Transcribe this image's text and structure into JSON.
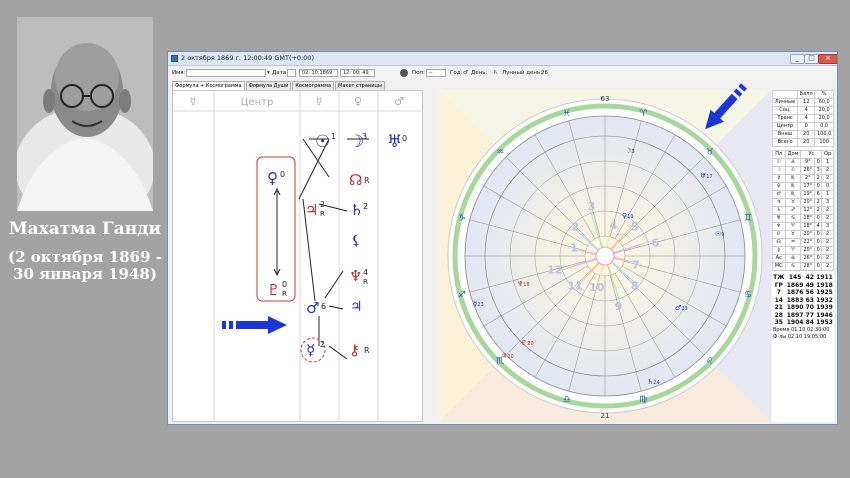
{
  "caption": {
    "name": "Махатма Ганди",
    "dates": "(2 октября 1869 - 30 января 1948)"
  },
  "window": {
    "title": "2 октября 1869 г. 12:00:49 GMT(+0:00)",
    "buttons": [
      "_",
      "□",
      "×"
    ]
  },
  "toolbar": {
    "name_label": "Имя:",
    "date_label": "Дата:",
    "date_value": "02. 10.1869",
    "time_value": "12: 00: 49",
    "sex_label": "Пол:",
    "sex_value": "--",
    "year_label": "Год:",
    "year_sym": "♂",
    "day_label": "День:",
    "day_sym": "♄",
    "lunar_label": "Лунный день:",
    "lunar_value": "26"
  },
  "tabs": [
    "Формула + Космограмма",
    "Формула Души",
    "Космограмма",
    "Макет страницы"
  ],
  "formula": {
    "headers": [
      "☿",
      "Центр",
      "☿",
      "♀",
      "♂"
    ],
    "planets": [
      {
        "sym": "☉",
        "num": "1",
        "color": "#1f35b8"
      },
      {
        "sym": "☽",
        "num": "3",
        "color": "#1f35b8"
      },
      {
        "sym": "♅",
        "num": "0",
        "color": "#1f35b8"
      },
      {
        "sym": "♀",
        "num": "0",
        "color": "#1f35b8"
      },
      {
        "sym": "☊",
        "num": "R",
        "color": "#c0281c"
      },
      {
        "sym": "♃",
        "num": "2",
        "sub": "R",
        "color": "#c0281c"
      },
      {
        "sym": "♄",
        "num": "2",
        "color": "#1f35b8"
      },
      {
        "sym": "⚸",
        "num": "",
        "color": "#1f35b8"
      },
      {
        "sym": "♆",
        "num": "4",
        "sub": "R",
        "color": "#c0281c"
      },
      {
        "sym": "♇",
        "num": "0",
        "sub": "R",
        "color": "#c0281c"
      },
      {
        "sym": "♂",
        "num": "6",
        "color": "#1f35b8"
      },
      {
        "sym": "♃",
        "num": "",
        "color": "#1f35b8"
      },
      {
        "sym": "☿",
        "num": "2",
        "color": "#1f35b8"
      },
      {
        "sym": "⚷",
        "num": "R",
        "color": "#c0281c"
      }
    ]
  },
  "chart": {
    "outer_numbers": [
      "63",
      "21"
    ],
    "house_numbers": [
      "1",
      "2",
      "3",
      "4",
      "5",
      "6",
      "7",
      "8",
      "9",
      "10",
      "11",
      "12"
    ],
    "planet_labels": [
      {
        "sym": "☽",
        "deg": "3"
      },
      {
        "sym": "♅",
        "deg": "17"
      },
      {
        "sym": "☉",
        "deg": "9"
      },
      {
        "sym": "♀",
        "deg": "19"
      },
      {
        "sym": "♆",
        "deg": "18"
      },
      {
        "sym": "♇",
        "deg": "20"
      },
      {
        "sym": "☿",
        "deg": "23"
      },
      {
        "sym": "♂",
        "deg": "23"
      },
      {
        "sym": "♃",
        "deg": "20"
      },
      {
        "sym": "♄",
        "deg": "24"
      }
    ],
    "zodiac": [
      "♈",
      "♉",
      "♊",
      "♋",
      "♌",
      "♍",
      "♎",
      "♏",
      "♐",
      "♑",
      "♒",
      "♓"
    ]
  },
  "side": {
    "head": [
      "",
      "Балл",
      "%"
    ],
    "summary": [
      [
        "Личные",
        "12",
        "60,0"
      ],
      [
        "Соц.",
        "4",
        "20,0"
      ],
      [
        "Транс",
        "4",
        "20,0"
      ],
      [
        "Центр",
        "0",
        "0,0"
      ],
      [
        "Внеш",
        "20",
        "100,0"
      ],
      [
        "Всего",
        "20",
        "100"
      ]
    ],
    "planet_head": [
      "Пл",
      "Дом",
      "Ус",
      "Ор"
    ],
    "planets": [
      [
        "☉",
        "♎",
        "9°",
        "0",
        "1"
      ],
      [
        "☽",
        "♌",
        "26°",
        "3",
        "2"
      ],
      [
        "☿",
        "♏",
        "2°",
        "2",
        "2"
      ],
      [
        "♀",
        "♏",
        "17°",
        "0",
        "0"
      ],
      [
        "♂",
        "♏",
        "19°",
        "6",
        "1"
      ],
      [
        "♃",
        "♉",
        "20°",
        "2",
        "3"
      ],
      [
        "♄",
        "♐",
        "12°",
        "2",
        "2"
      ],
      [
        "♅",
        "♋",
        "18°",
        "0",
        "2"
      ],
      [
        "♆",
        "♈",
        "18°",
        "4",
        "3"
      ],
      [
        "♇",
        "♉",
        "20°",
        "0",
        "2"
      ],
      [
        "☊",
        "♒",
        "22°",
        "0",
        "2"
      ],
      [
        "⚷",
        "♈",
        "20°",
        "0",
        "2"
      ],
      [
        "Ас",
        "♎",
        "26°",
        "0",
        "2"
      ],
      [
        "МС",
        "♋",
        "28°",
        "0",
        "2"
      ]
    ],
    "years_head": [
      "ТЖ",
      "145",
      "42",
      "1911"
    ],
    "years": [
      [
        "ГР",
        "1869",
        "49",
        "1918"
      ],
      [
        "7",
        "1876",
        "56",
        "1925"
      ],
      [
        "14",
        "1883",
        "63",
        "1932"
      ],
      [
        "21",
        "1890",
        "70",
        "1939"
      ],
      [
        "28",
        "1897",
        "77",
        "1946"
      ],
      [
        "35",
        "1904",
        "84",
        "1953"
      ]
    ],
    "time_label": "Время",
    "time_value": "01.10 02:30:00",
    "phase_label": "Ф-лы",
    "phase_value": "02.10 19:05:00"
  },
  "colors": {
    "blue": "#1f35b8",
    "red": "#c0281c",
    "arrow": "#1c36d6"
  }
}
